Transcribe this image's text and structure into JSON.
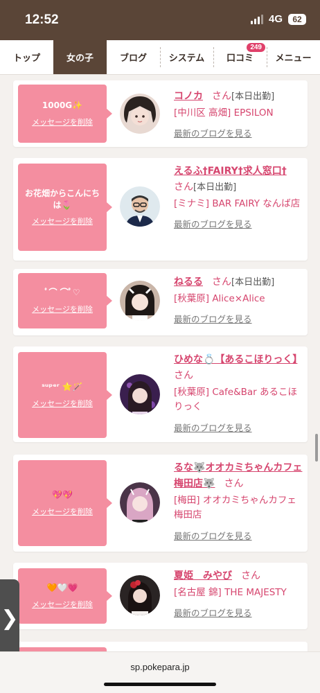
{
  "status": {
    "time": "12:52",
    "network": "4G",
    "battery": "62"
  },
  "nav": {
    "items": [
      {
        "label": "トップ",
        "active": false
      },
      {
        "label": "女の子",
        "active": true
      },
      {
        "label": "ブログ",
        "active": false
      },
      {
        "label": "システム",
        "active": false
      },
      {
        "label": "口コミ",
        "active": false,
        "badge": "249"
      },
      {
        "label": "メニュー",
        "active": false
      }
    ]
  },
  "delete_label": "メッセージを削除",
  "blog_link_label": "最新のブログを見る",
  "girls": [
    {
      "message": "1000G✨",
      "name": "コノカ",
      "suffix": "さん",
      "status": "[本日出勤]",
      "shop": "[中川区 高畑] EPSILON",
      "avatar": "avatar-girl"
    },
    {
      "message": "お花畑からこんにちは🌷",
      "name": "えるふ†FAIRY†求人窓口†",
      "suffix": "さん",
      "status": "[本日出勤]",
      "shop": "[ミナミ] BAR FAIRY なんば店",
      "avatar": "avatar-man"
    },
    {
      "message": "ﾟ⌒ ⌒ﾟ♡",
      "name": "ねるる",
      "suffix": "さん",
      "status": "[本日出勤]",
      "shop": "[秋葉原] Alice×Alice",
      "avatar": "avatar-girl"
    },
    {
      "message": "ˢᵘᵖᵉʳ ⭐️🪄",
      "name": "ひめな💍【あるこほりっく】",
      "suffix": "さん",
      "status": "",
      "shop": "[秋葉原] Cafe&Bar あるこほりっく",
      "avatar": "avatar-girl"
    },
    {
      "message": "💖💖",
      "name": "るな🐺オオカミちゃんカフェ梅田店🐺",
      "suffix": "さん",
      "status": "",
      "shop": "[梅田] オオカミちゃんカフェ梅田店",
      "avatar": "avatar-girl"
    },
    {
      "message": "🧡🤍💗",
      "name": "夏姫　みやび",
      "suffix": "さん",
      "status": "",
      "shop": "[名古屋 錦] THE MAJESTY",
      "avatar": "avatar-girl"
    }
  ],
  "url": "sp.pokepara.jp",
  "side_tab_icon": "chevron-right-icon",
  "colors": {
    "brand_brown": "#5a4537",
    "bubble_pink": "#f48ea0",
    "name_pink": "#d6456e",
    "badge_red": "#e0406a"
  }
}
